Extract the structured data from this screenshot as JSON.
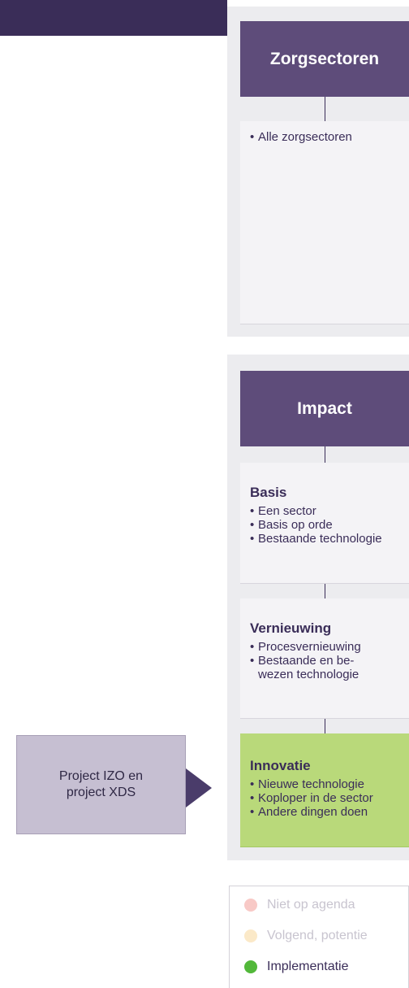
{
  "sector_column": {
    "header": "Zorgsectoren",
    "items": [
      "Alle zorgsectoren"
    ]
  },
  "impact_column": {
    "header": "Impact",
    "levels": [
      {
        "title": "Basis",
        "items": [
          "Een sector",
          "Basis op orde",
          "Bestaande technologie"
        ]
      },
      {
        "title": "Vernieuwing",
        "items": [
          "Procesvernieuwing",
          "Bestaande en be-\nwezen technologie"
        ]
      },
      {
        "title": "Innovatie",
        "items": [
          "Nieuwe technologie",
          "Koploper in de sector",
          "Andere dingen doen"
        ]
      }
    ],
    "highlighted_level": "Innovatie"
  },
  "project": {
    "label": "Project IZO en\nproject XDS"
  },
  "legend": {
    "items": [
      {
        "label": "Niet op agenda",
        "color": "#f8c9c6",
        "active": false
      },
      {
        "label": "Volgend, potentie",
        "color": "#fbe9c8",
        "active": false
      },
      {
        "label": "Implementatie",
        "color": "#52b83a",
        "active": true
      }
    ]
  },
  "colors": {
    "header_bg": "#5e4c7a",
    "topbar": "#3a2d58",
    "highlight": "#b9d97a",
    "project_box": "#c6bfd2",
    "arrow": "#4a3c6a"
  }
}
